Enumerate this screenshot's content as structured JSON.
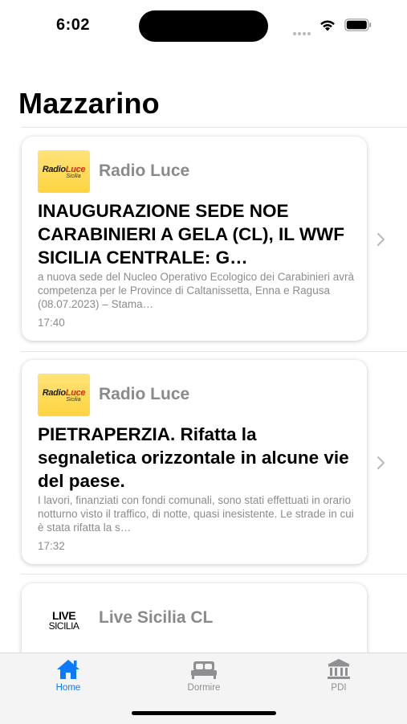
{
  "status_bar": {
    "time": "6:02"
  },
  "page": {
    "title": "Mazzarino"
  },
  "cards": [
    {
      "source": "Radio Luce",
      "logo": {
        "main_a": "Radio",
        "main_b": "Luce",
        "sub": "Sicilia"
      },
      "headline": "INAUGURAZIONE SEDE NOE CARABINIERI A GELA (CL), IL WWF SICILIA CENTRALE: G…",
      "summary": "a nuova sede del Nucleo Operativo Ecologico dei Carabinieri avrà competenza per le Province di Caltanissetta, Enna e Ragusa (08.07.2023) – Stama…",
      "time": "17:40"
    },
    {
      "source": "Radio Luce",
      "logo": {
        "main_a": "Radio",
        "main_b": "Luce",
        "sub": "Sicilia"
      },
      "headline": "PIETRAPERZIA. Rifatta la segnaletica orizzontale in alcune vie del paese.",
      "summary": "I lavori, finanziati con fondi comunali, sono stati effettuati in orario notturno visto il traffico, di notte, quasi inesistente. Le strade in cui è stata rifatta la s…",
      "time": "17:32"
    },
    {
      "source": "Live Sicilia CL",
      "logo": {
        "line1": "LIVE",
        "line2": "SICILIA"
      }
    }
  ],
  "tab_bar": {
    "tabs": [
      {
        "label": "Home",
        "icon": "house-icon",
        "active": true
      },
      {
        "label": "Dormire",
        "icon": "bed-icon",
        "active": false
      },
      {
        "label": "PDI",
        "icon": "bank-icon",
        "active": false
      }
    ],
    "accent": "#0a7aff",
    "inactive": "#8e8e93"
  }
}
